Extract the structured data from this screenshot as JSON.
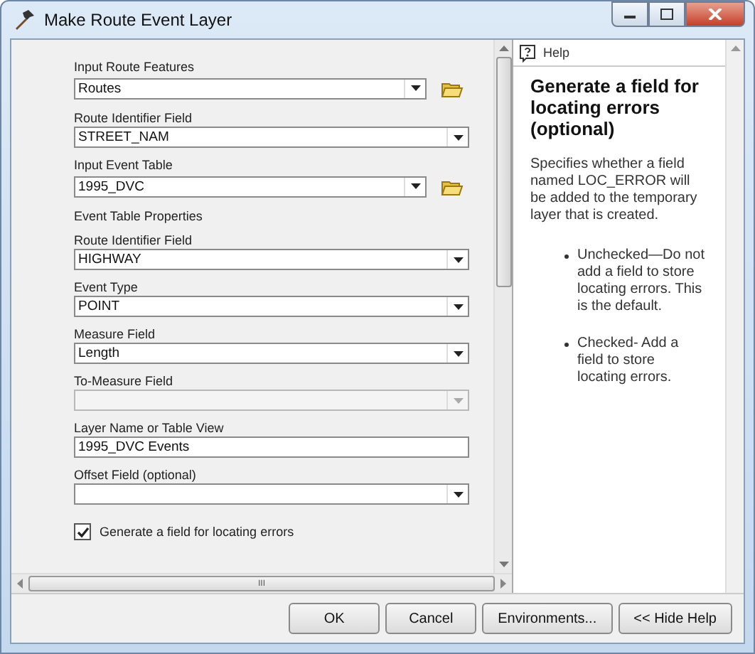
{
  "window": {
    "title": "Make Route Event Layer"
  },
  "form": [
    {
      "kind": "combo",
      "label": "Input Route Features",
      "value": "Routes",
      "browse": true,
      "disabled": false
    },
    {
      "kind": "combo",
      "label": "Route Identifier Field",
      "value": "STREET_NAM",
      "browse": false,
      "disabled": false
    },
    {
      "kind": "combo",
      "label": "Input Event Table",
      "value": "1995_DVC",
      "browse": true,
      "disabled": false
    },
    {
      "kind": "heading",
      "label": "Event Table Properties"
    },
    {
      "kind": "combo",
      "label": "Route Identifier Field",
      "value": "HIGHWAY",
      "browse": false,
      "disabled": false
    },
    {
      "kind": "combo",
      "label": "Event Type",
      "value": "POINT",
      "browse": false,
      "disabled": false
    },
    {
      "kind": "combo",
      "label": "Measure Field",
      "value": "Length",
      "browse": false,
      "disabled": false
    },
    {
      "kind": "combo",
      "label": "To-Measure Field",
      "browse": false,
      "disabled": true
    },
    {
      "kind": "text",
      "label": "Layer Name or Table View",
      "value": "1995_DVC Events"
    },
    {
      "kind": "combo",
      "label": "Offset Field (optional)",
      "browse": false,
      "disabled": false
    },
    {
      "kind": "checkbox",
      "label": "Generate a field for locating errors",
      "checked": true
    }
  ],
  "help": {
    "tab": "Help",
    "title": "Generate a field for locating errors (optional)",
    "text": "Specifies whether a field named LOC_ERROR will be added to the temporary layer that is created.",
    "bullets": [
      "Unchecked—Do not add a field to store locating errors. This is the default.",
      "Checked- Add a field to store locating errors."
    ]
  },
  "horizontal_scroll": {
    "grip": "III"
  },
  "buttons": [
    "OK",
    "Cancel",
    "Environments...",
    "<< Hide Help"
  ]
}
